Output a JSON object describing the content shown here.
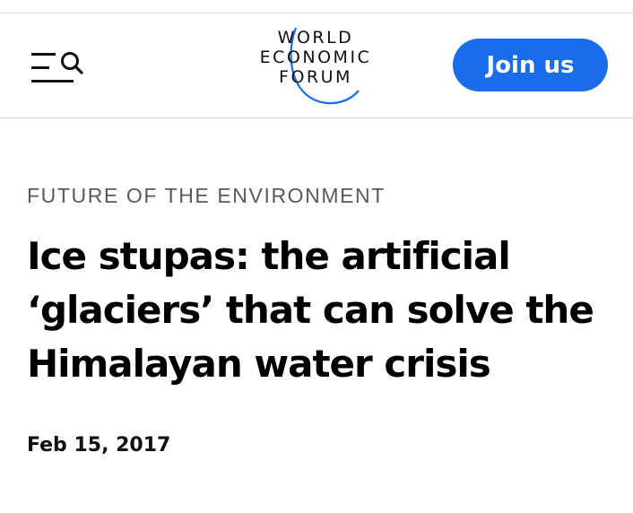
{
  "header": {
    "menu_icon": "menu-search-icon",
    "logo": {
      "line1": "WORLD",
      "line2": "ECONOMIC",
      "line3": "FORUM",
      "arc_color": "#1a6dea"
    },
    "join_label": "Join us",
    "join_color": "#1a6dea"
  },
  "article": {
    "category": "FUTURE OF THE ENVIRONMENT",
    "title": "Ice stupas: the artificial ‘glaciers’ that can solve the Himalayan water crisis",
    "date": "Feb 15, 2017"
  }
}
